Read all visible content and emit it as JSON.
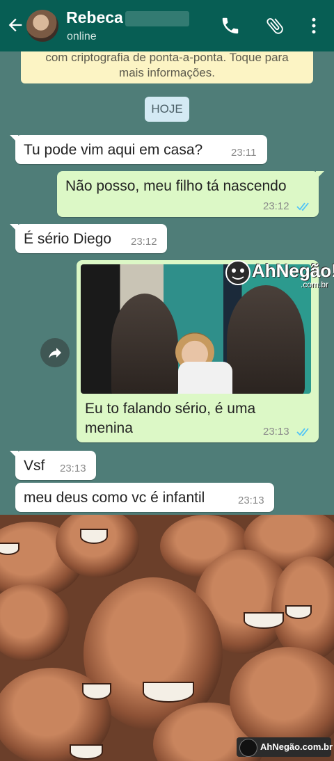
{
  "header": {
    "contact_name": "Rebeca",
    "status": "online",
    "icons": [
      "back-arrow-icon",
      "phone-icon",
      "paperclip-icon",
      "more-vert-icon"
    ],
    "color": "#075e54"
  },
  "encryption_notice": {
    "line1": "com criptografia de ponta-a-ponta. Toque para",
    "line2": "mais informações."
  },
  "date_divider": "HOJE",
  "messages": [
    {
      "direction": "in",
      "text": "Tu pode vim aqui em casa?",
      "time": "23:11"
    },
    {
      "direction": "out",
      "text": "Não posso, meu filho tá nascendo",
      "time": "23:12",
      "read": true
    },
    {
      "direction": "in",
      "text": "É sério Diego",
      "time": "23:12"
    },
    {
      "direction": "out",
      "type": "image",
      "caption_line1": "Eu to falando sério, é uma",
      "caption_line2": "menina",
      "time": "23:13",
      "read": true
    },
    {
      "direction": "in",
      "text": "Vsf",
      "time": "23:13"
    },
    {
      "direction": "in",
      "text": "meu deus como vc é infantil",
      "time": "23:13"
    }
  ],
  "watermark": {
    "brand": "AhNegão!",
    "sub": ".com.br"
  },
  "footer_watermark": "AhNegão.com.br",
  "colors": {
    "chat_bg": "#4f7d78",
    "outgoing": "#dcf8c6",
    "incoming": "#ffffff",
    "tick_read": "#4fc3f7"
  }
}
